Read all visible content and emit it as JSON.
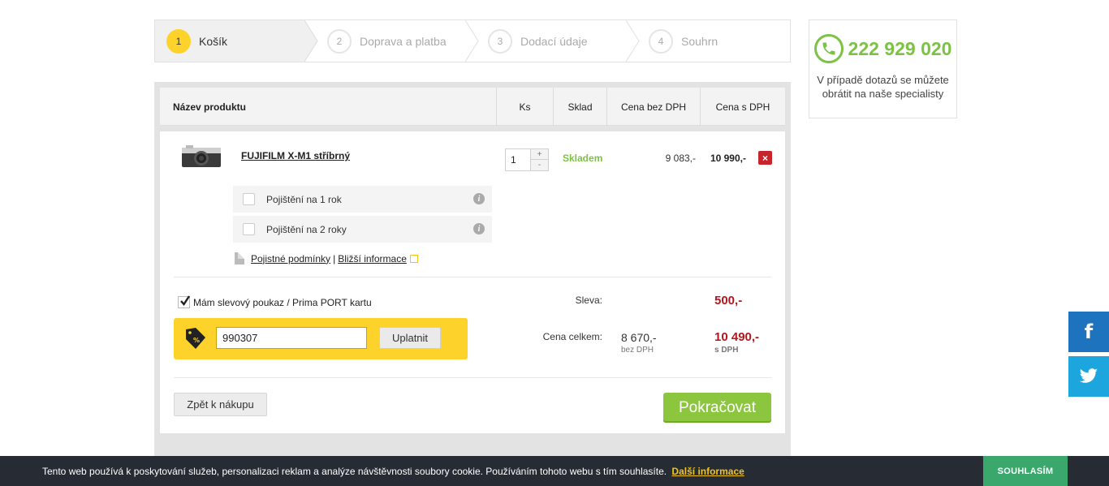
{
  "steps": [
    {
      "num": "1",
      "label": "Košík",
      "active": true
    },
    {
      "num": "2",
      "label": "Doprava a platba"
    },
    {
      "num": "3",
      "label": "Dodací údaje"
    },
    {
      "num": "4",
      "label": "Souhrn"
    }
  ],
  "contact": {
    "phone": "222 929 020",
    "text": "V případě dotazů se můžete obrátit na naše specialisty"
  },
  "table": {
    "headers": [
      "Název produktu",
      "Ks",
      "Sklad",
      "Cena bez DPH",
      "Cena s DPH"
    ]
  },
  "product": {
    "name": "FUJIFILM X-M1 stříbrný",
    "quantity": "1",
    "qty_plus": "+",
    "qty_minus": "-",
    "stock": "Skladem",
    "price_net": "9 083,-",
    "price_gross": "10 990,-",
    "remove": "×"
  },
  "insurance": {
    "options": [
      "Pojištění na 1 rok",
      "Pojištění na 2 roky"
    ],
    "info": "i",
    "terms_link": "Pojistné podmínky",
    "separator": "|",
    "more_link": "Bližší informace"
  },
  "voucher": {
    "checkbox_label": "Mám slevový poukaz / Prima PORT kartu",
    "checked": true,
    "code": "990307",
    "apply_label": "Uplatnit"
  },
  "summary": {
    "discount_label": "Sleva:",
    "discount_value": "500,-",
    "total_label": "Cena celkem:",
    "total_net": "8 670,-",
    "total_net_sub": "bez DPH",
    "total_gross": "10 490,-",
    "total_gross_sub": "s DPH"
  },
  "actions": {
    "back": "Zpět k nákupu",
    "continue": "Pokračovat"
  },
  "social": {
    "facebook": "f",
    "twitter": "twitter-icon"
  },
  "cookie": {
    "text": "Tento web používá k poskytování služeb, personalizaci reklam a analýze návštěvnosti soubory cookie. Používáním tohoto webu s tím souhlasíte.",
    "link": "Další informace",
    "accept": "SOUHLASÍM"
  },
  "colors": {
    "accent_yellow": "#fdd22b",
    "green": "#7cc244",
    "button_green": "#8cc63f",
    "price_red": "#b4161d",
    "facebook": "#1e73be",
    "twitter": "#1da5dd",
    "cookie_bar": "#272b33",
    "cookie_accept": "#3aa76d"
  }
}
